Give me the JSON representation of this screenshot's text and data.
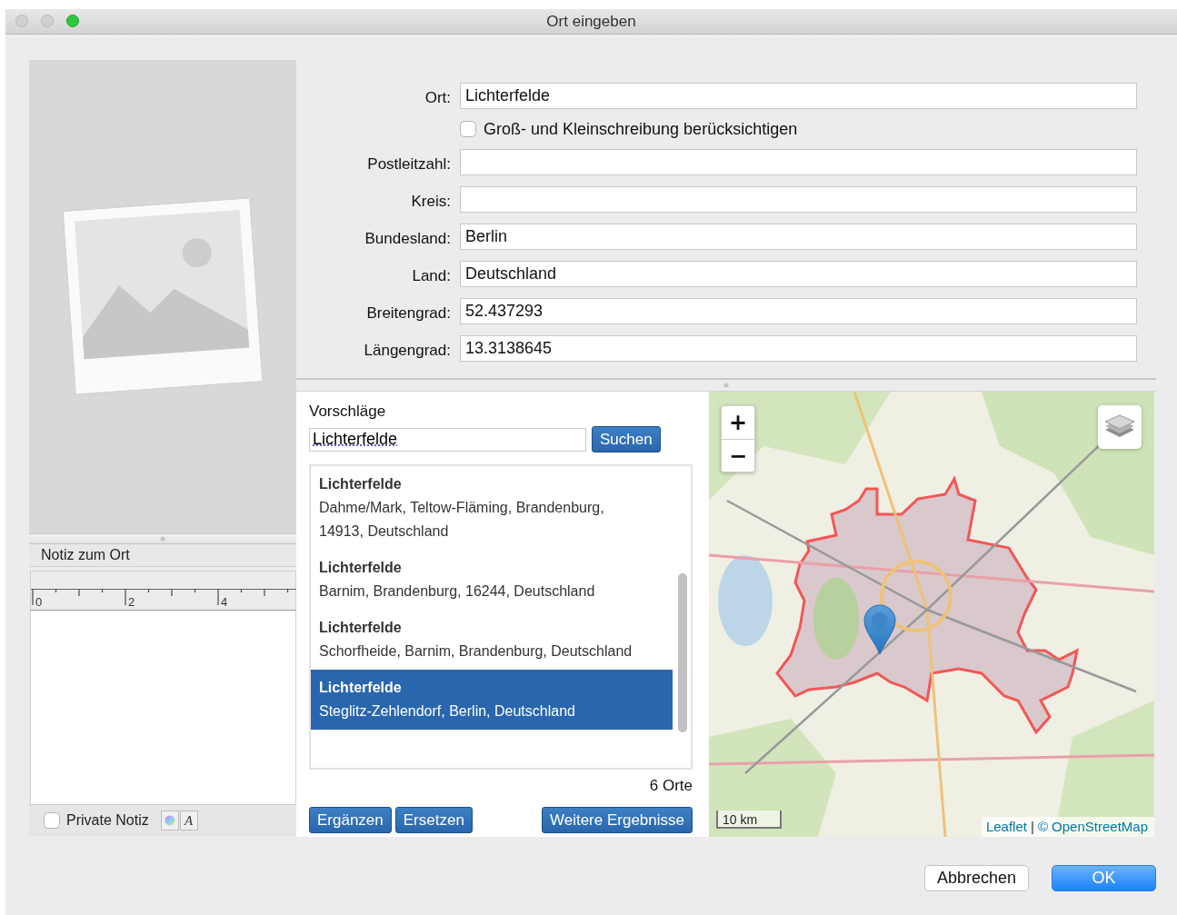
{
  "window": {
    "title": "Ort eingeben"
  },
  "form": {
    "fields": [
      {
        "kind": "text",
        "label": "Ort:",
        "value": "Lichterfelde"
      },
      {
        "kind": "checkbox",
        "label": "Groß- und Kleinschreibung berücksichtigen",
        "checked": false
      },
      {
        "kind": "text",
        "label": "Postleitzahl:"
      },
      {
        "kind": "text",
        "label": "Kreis:"
      },
      {
        "kind": "text",
        "label": "Bundesland:",
        "value": "Berlin"
      },
      {
        "kind": "text",
        "label": "Land:",
        "value": "Deutschland"
      },
      {
        "kind": "text",
        "label": "Breitengrad:",
        "value": "52.437293"
      },
      {
        "kind": "text",
        "label": "Längengrad:",
        "value": "13.3138645"
      }
    ]
  },
  "note": {
    "title": "Notiz zum Ort",
    "ruler_labels": [
      "0",
      "2",
      "4"
    ],
    "private": {
      "label": "Private Notiz",
      "checked": false
    },
    "font_button": "A"
  },
  "suggestions": {
    "title": "Vorschläge",
    "search_value": "Lichterfelde",
    "search_button": "Suchen",
    "results": [
      {
        "name": "Lichterfelde",
        "detail": "Dahme/Mark, Teltow-Fläming, Brandenburg, 14913, Deutschland",
        "selected": false
      },
      {
        "name": "Lichterfelde",
        "detail": "Barnim, Brandenburg, 16244, Deutschland",
        "selected": false
      },
      {
        "name": "Lichterfelde",
        "detail": "Schorfheide, Barnim, Brandenburg, Deutschland",
        "selected": false
      },
      {
        "name": "Lichterfelde",
        "detail": "Steglitz-Zehlendorf, Berlin, Deutschland",
        "selected": true
      }
    ],
    "count": "6 Orte",
    "buttons": [
      "Ergänzen",
      "Ersetzen"
    ],
    "more_button": "Weitere Ergebnisse"
  },
  "map": {
    "zoom_in": "+",
    "zoom_out": "−",
    "scale": "10 km",
    "attribution": [
      "Leaflet",
      "|",
      "© OpenStreetMap"
    ]
  },
  "buttons": [
    {
      "label": "Abbrechen",
      "default": false
    },
    {
      "label": "OK",
      "default": true
    }
  ]
}
